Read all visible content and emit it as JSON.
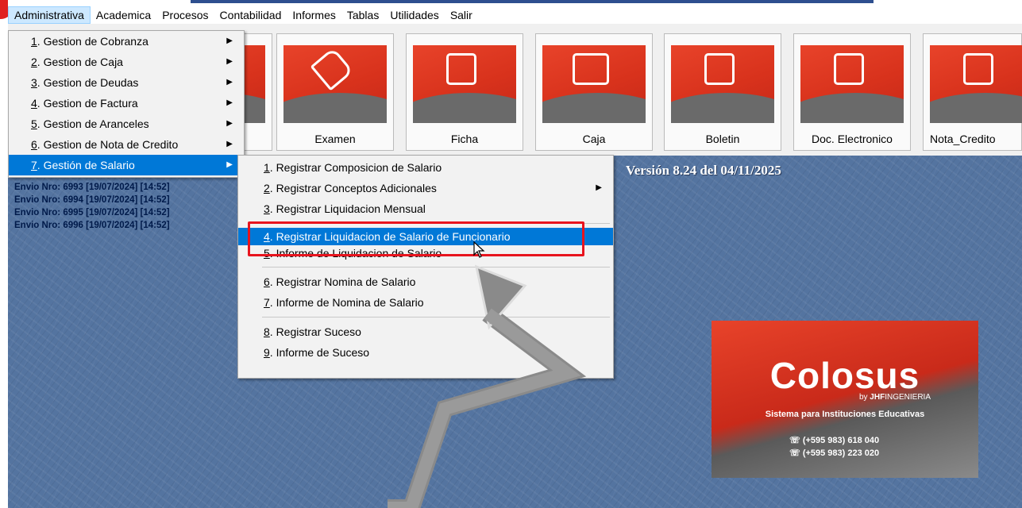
{
  "menubar": {
    "items": [
      "Administrativa",
      "Academica",
      "Procesos",
      "Contabilidad",
      "Informes",
      "Tablas",
      "Utilidades",
      "Salir"
    ]
  },
  "toolbar": {
    "tiles": [
      {
        "label": "",
        "icon": "tag-icon"
      },
      {
        "label": "Examen",
        "icon": "tag-icon"
      },
      {
        "label": "Ficha",
        "icon": "document-hand-icon"
      },
      {
        "label": "Caja",
        "icon": "cash-register-icon"
      },
      {
        "label": "Boletin",
        "icon": "shopping-bag-icon"
      },
      {
        "label": "Doc. Electronico",
        "icon": "shopping-bag-icon"
      },
      {
        "label": "Nota_Credito",
        "icon": "shopping-bag-icon"
      }
    ]
  },
  "admin_menu": {
    "items": [
      {
        "num": "1",
        "label": ". Gestion de Cobranza"
      },
      {
        "num": "2",
        "label": ". Gestion de Caja"
      },
      {
        "num": "3",
        "label": ". Gestion de Deudas"
      },
      {
        "num": "4",
        "label": ". Gestion de Factura"
      },
      {
        "num": "5",
        "label": ". Gestion de Aranceles"
      },
      {
        "num": "6",
        "label": ". Gestion de Nota de Credito"
      },
      {
        "num": "7",
        "label": ". Gestión de Salario"
      }
    ]
  },
  "salario_menu": {
    "items": [
      {
        "num": "1",
        "label": ". Registrar Composicion de Salario"
      },
      {
        "num": "2",
        "label": ". Registrar Conceptos Adicionales"
      },
      {
        "num": "3",
        "label": ". Registrar Liquidacion Mensual"
      },
      {
        "num": "4",
        "label": ". Registrar Liquidacion de Salario de Funcionario"
      },
      {
        "num": "5",
        "label": ". Informe de Liquidacion de Salario"
      },
      {
        "num": "6",
        "label": ". Registrar Nomina de Salario"
      },
      {
        "num": "7",
        "label": ". Informe de Nomina de Salario"
      },
      {
        "num": "8",
        "label": ". Registrar Suceso"
      },
      {
        "num": "9",
        "label": ". Informe de Suceso"
      }
    ]
  },
  "log": [
    "Envio Nro: 6993  [19/07/2024]   [14:52]",
    "Envio Nro: 6994  [19/07/2024]   [14:52]",
    "Envio Nro: 6995  [19/07/2024]   [14:52]",
    "Envio Nro: 6996  [19/07/2024]   [14:52]"
  ],
  "version": "Versión 8.24 del 04/11/2025",
  "logo": {
    "brand": "Colosus",
    "by": "by",
    "by_company": "JHF",
    "by_company_rest": "INGENIERIA",
    "subtitle": "Sistema para Instituciones Educativas",
    "phone1": "(+595 983) 618 040",
    "phone2": "(+595 983) 223 020"
  },
  "colors": {
    "highlight_box": "#e8141e",
    "menu_selection": "#0078d7",
    "tile_red": "#e8432a"
  }
}
